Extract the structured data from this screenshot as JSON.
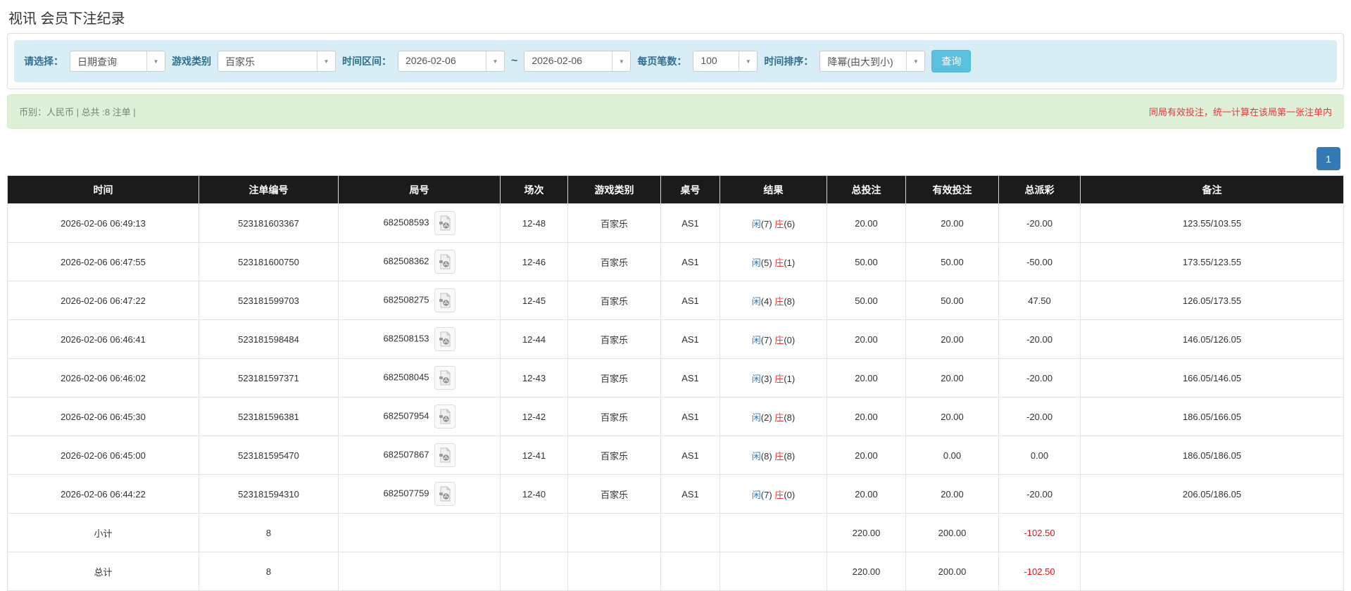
{
  "page": {
    "title": "视讯 会员下注纪录"
  },
  "filters": {
    "select_label": "请选择：",
    "select_value": "日期查询",
    "game_type_label": "游戏类别",
    "game_type_value": "百家乐",
    "time_range_label": "时间区间：",
    "date_from": "2026-02-06",
    "date_separator": "~",
    "date_to": "2026-02-06",
    "page_size_label": "每页笔数：",
    "page_size_value": "100",
    "sort_label": "时间排序：",
    "sort_value": "降幂(由大到小)",
    "search_button": "查询",
    "caret_icon": "▼"
  },
  "summary": {
    "left_text": "币别：人民币 | 总共 :8 注单 |",
    "right_text": "同局有效投注，统一计算在该局第一张注单内"
  },
  "pagination": {
    "current_page": "1"
  },
  "colors": {
    "accent_blue": "#337ab7",
    "result_red": "#e8393c",
    "negative_red": "#e8271c",
    "highlight_yellow": "#fcfc9e",
    "filter_bar_bg": "#d9edf7",
    "summary_bg": "#dff0d8",
    "header_bg": "#1b1b1b",
    "footer_bg": "#9a9a9a",
    "search_btn_bg": "#5bc0de"
  },
  "table": {
    "headers": [
      "时间",
      "注单编号",
      "局号",
      "场次",
      "游戏类别",
      "桌号",
      "结果",
      "总投注",
      "有效投注",
      "总派彩",
      "备注"
    ],
    "video_icon_name": "video-record-icon",
    "rows": [
      {
        "time": "2026-02-06 06:49:13",
        "bet_id": "523181603367",
        "round_id": "682508593",
        "session": "12-48",
        "game_type": "百家乐",
        "table_id": "AS1",
        "result": {
          "player": "闲",
          "player_score": "(7)",
          "banker": "庄",
          "banker_score": "(6)"
        },
        "total_bet": "20.00",
        "valid_bet": "20.00",
        "payout": "-20.00",
        "remark": "123.55/103.55",
        "highlighted": false
      },
      {
        "time": "2026-02-06 06:47:55",
        "bet_id": "523181600750",
        "round_id": "682508362",
        "session": "12-46",
        "game_type": "百家乐",
        "table_id": "AS1",
        "result": {
          "player": "闲",
          "player_score": "(5)",
          "banker": "庄",
          "banker_score": "(1)"
        },
        "total_bet": "50.00",
        "valid_bet": "50.00",
        "payout": "-50.00",
        "remark": "173.55/123.55",
        "highlighted": false
      },
      {
        "time": "2026-02-06 06:47:22",
        "bet_id": "523181599703",
        "round_id": "682508275",
        "session": "12-45",
        "game_type": "百家乐",
        "table_id": "AS1",
        "result": {
          "player": "闲",
          "player_score": "(4)",
          "banker": "庄",
          "banker_score": "(8)"
        },
        "total_bet": "50.00",
        "valid_bet": "50.00",
        "payout": "47.50",
        "remark": "126.05/173.55",
        "highlighted": false
      },
      {
        "time": "2026-02-06 06:46:41",
        "bet_id": "523181598484",
        "round_id": "682508153",
        "session": "12-44",
        "game_type": "百家乐",
        "table_id": "AS1",
        "result": {
          "player": "闲",
          "player_score": "(7)",
          "banker": "庄",
          "banker_score": "(0)"
        },
        "total_bet": "20.00",
        "valid_bet": "20.00",
        "payout": "-20.00",
        "remark": "146.05/126.05",
        "highlighted": false
      },
      {
        "time": "2026-02-06 06:46:02",
        "bet_id": "523181597371",
        "round_id": "682508045",
        "session": "12-43",
        "game_type": "百家乐",
        "table_id": "AS1",
        "result": {
          "player": "闲",
          "player_score": "(3)",
          "banker": "庄",
          "banker_score": "(1)"
        },
        "total_bet": "20.00",
        "valid_bet": "20.00",
        "payout": "-20.00",
        "remark": "166.05/146.05",
        "highlighted": false
      },
      {
        "time": "2026-02-06 06:45:30",
        "bet_id": "523181596381",
        "round_id": "682507954",
        "session": "12-42",
        "game_type": "百家乐",
        "table_id": "AS1",
        "result": {
          "player": "闲",
          "player_score": "(2)",
          "banker": "庄",
          "banker_score": "(8)"
        },
        "total_bet": "20.00",
        "valid_bet": "20.00",
        "payout": "-20.00",
        "remark": "186.05/166.05",
        "highlighted": true
      },
      {
        "time": "2026-02-06 06:45:00",
        "bet_id": "523181595470",
        "round_id": "682507867",
        "session": "12-41",
        "game_type": "百家乐",
        "table_id": "AS1",
        "result": {
          "player": "闲",
          "player_score": "(8)",
          "banker": "庄",
          "banker_score": "(8)"
        },
        "total_bet": "20.00",
        "valid_bet": "0.00",
        "payout": "0.00",
        "remark": "186.05/186.05",
        "highlighted": false
      },
      {
        "time": "2026-02-06 06:44:22",
        "bet_id": "523181594310",
        "round_id": "682507759",
        "session": "12-40",
        "game_type": "百家乐",
        "table_id": "AS1",
        "result": {
          "player": "闲",
          "player_score": "(7)",
          "banker": "庄",
          "banker_score": "(0)"
        },
        "total_bet": "20.00",
        "valid_bet": "20.00",
        "payout": "-20.00",
        "remark": "206.05/186.05",
        "highlighted": false
      }
    ],
    "footer_rows": [
      {
        "label": "小计",
        "count": "8",
        "total_bet": "220.00",
        "valid_bet": "200.00",
        "payout": "-102.50"
      },
      {
        "label": "总计",
        "count": "8",
        "total_bet": "220.00",
        "valid_bet": "200.00",
        "payout": "-102.50"
      }
    ]
  }
}
